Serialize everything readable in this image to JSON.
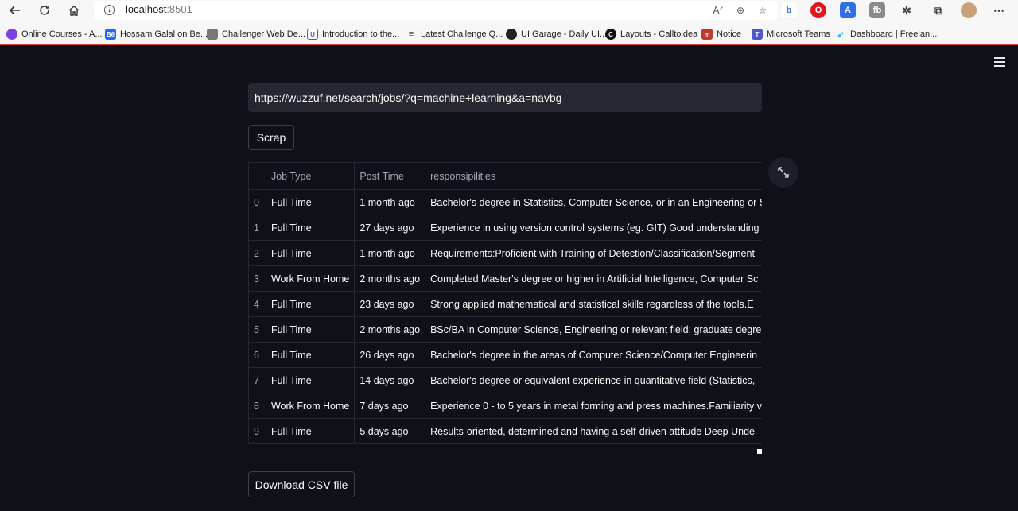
{
  "browser": {
    "address": "localhost",
    "port": ":8501",
    "bookmarks": [
      {
        "label": "Online Courses - A...",
        "color": "#7b3fe4",
        "glyph": "⬤"
      },
      {
        "label": "Hossam Galal on Be...",
        "color": "#1769ff",
        "glyph": "Bē"
      },
      {
        "label": "Challenger Web De...",
        "color": "#777777",
        "glyph": "▦"
      },
      {
        "label": "Introduction to the...",
        "color": "#5a4fcf",
        "glyph": "U"
      },
      {
        "label": "Latest Challenge Q...",
        "color": "#555555",
        "glyph": "≡"
      },
      {
        "label": "UI Garage - Daily UI...",
        "color": "#222222",
        "glyph": "◐"
      },
      {
        "label": "Layouts - Calltoidea",
        "color": "#111111",
        "glyph": "C"
      },
      {
        "label": "Notice",
        "color": "#c0392b",
        "glyph": "m"
      },
      {
        "label": "Microsoft Teams",
        "color": "#5059c9",
        "glyph": "T"
      },
      {
        "label": "Dashboard | Freelan...",
        "color": "#29b2fe",
        "glyph": "➶"
      }
    ]
  },
  "app": {
    "url_value": "https://wuzzuf.net/search/jobs/?q=machine+learning&a=navbg",
    "scrap_label": "Scrap",
    "download_label": "Download CSV file",
    "table": {
      "columns": [
        "Job Type",
        "Post Time",
        "responsipilities"
      ],
      "rows": [
        {
          "idx": "0",
          "type": "Full Time",
          "time": "1 month ago",
          "resp": "Bachelor's degree in Statistics, Computer Science, or in an Engineering or S"
        },
        {
          "idx": "1",
          "type": "Full Time",
          "time": "27 days ago",
          "resp": "Experience in using version control systems (eg. GIT)  Good understanding"
        },
        {
          "idx": "2",
          "type": "Full Time",
          "time": "1 month ago",
          "resp": "Requirements:Proficient with Training of Detection/Classification/Segment"
        },
        {
          "idx": "3",
          "type": "Work From Home",
          "time": "2 months ago",
          "resp": "Completed Master's degree or higher in Artificial Intelligence, Computer Sc"
        },
        {
          "idx": "4",
          "type": "Full Time",
          "time": "23 days ago",
          "resp": "Strong applied mathematical and statistical skills regardless of the tools.E"
        },
        {
          "idx": "5",
          "type": "Full Time",
          "time": "2 months ago",
          "resp": "BSc/BA in Computer Science, Engineering or relevant field; graduate degre"
        },
        {
          "idx": "6",
          "type": "Full Time",
          "time": "26 days ago",
          "resp": "Bachelor's degree in the areas of Computer Science/Computer Engineerin"
        },
        {
          "idx": "7",
          "type": "Full Time",
          "time": "14 days ago",
          "resp": "Bachelor's degree or equivalent experience in quantitative field (Statistics,"
        },
        {
          "idx": "8",
          "type": "Work From Home",
          "time": "7 days ago",
          "resp": "Experience 0 - to 5 years in metal forming and press machines.Familiarity v"
        },
        {
          "idx": "9",
          "type": "Full Time",
          "time": "5 days ago",
          "resp": "Results-oriented, determined and having a self-driven attitude Deep Unde"
        }
      ]
    }
  }
}
